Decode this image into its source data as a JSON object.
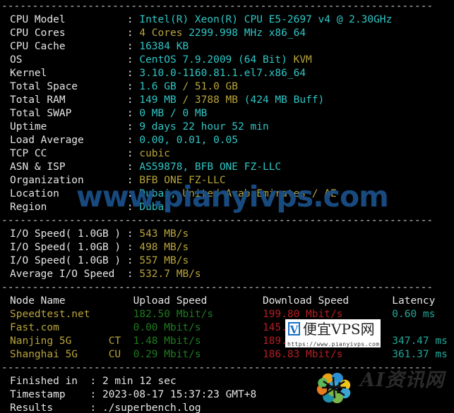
{
  "terminal": {
    "separator": "----------------------------------------------------------------------",
    "colon": ":"
  },
  "sysinfo": {
    "rows": [
      {
        "label": "CPU Model",
        "parts": [
          {
            "t": "Intel(R) Xeon(R) CPU E5-2697 v4 @ 2.30GHz",
            "c": "cy"
          }
        ]
      },
      {
        "label": "CPU Cores",
        "parts": [
          {
            "t": "4 Cores ",
            "c": "ye"
          },
          {
            "t": "2299.998 MHz ",
            "c": "cy"
          },
          {
            "t": "x86_64",
            "c": "cy"
          }
        ]
      },
      {
        "label": "CPU Cache",
        "parts": [
          {
            "t": "16384 KB",
            "c": "cy"
          }
        ]
      },
      {
        "label": "OS",
        "parts": [
          {
            "t": "CentOS 7.9.2009 (64 Bit) ",
            "c": "cy"
          },
          {
            "t": "KVM",
            "c": "ye"
          }
        ]
      },
      {
        "label": "Kernel",
        "parts": [
          {
            "t": "3.10.0-1160.81.1.el7.x86_64",
            "c": "cy"
          }
        ]
      },
      {
        "label": "Total Space",
        "parts": [
          {
            "t": "1.6 GB ",
            "c": "cy"
          },
          {
            "t": "/ 51.0 GB",
            "c": "ye"
          }
        ]
      },
      {
        "label": "Total RAM",
        "parts": [
          {
            "t": "149 MB ",
            "c": "cy"
          },
          {
            "t": "/ 3788 MB ",
            "c": "ye"
          },
          {
            "t": "(424 MB Buff)",
            "c": "cy"
          }
        ]
      },
      {
        "label": "Total SWAP",
        "parts": [
          {
            "t": "0 MB / 0 MB",
            "c": "cy"
          }
        ]
      },
      {
        "label": "Uptime",
        "parts": [
          {
            "t": "9 days 22 hour 52 min",
            "c": "cy"
          }
        ]
      },
      {
        "label": "Load Average",
        "parts": [
          {
            "t": "0.00, 0.01, 0.05",
            "c": "cy"
          }
        ]
      },
      {
        "label": "TCP CC",
        "parts": [
          {
            "t": "cubic",
            "c": "ye"
          }
        ]
      },
      {
        "label": "ASN & ISP",
        "parts": [
          {
            "t": "AS59878, BFB ONE FZ-LLC",
            "c": "cy"
          }
        ]
      },
      {
        "label": "Organization",
        "parts": [
          {
            "t": "BFB ONE FZ-LLC",
            "c": "ye"
          }
        ]
      },
      {
        "label": "Location",
        "parts": [
          {
            "t": "Dubai, ",
            "c": "cy"
          },
          {
            "t": "United Arab Emirates / AE",
            "c": "ye"
          }
        ]
      },
      {
        "label": "Region",
        "parts": [
          {
            "t": "Dubai",
            "c": "cy"
          }
        ]
      }
    ]
  },
  "iospeed": {
    "rows": [
      {
        "label": "I/O Speed( 1.0GB )",
        "parts": [
          {
            "t": "543 MB/s",
            "c": "ye"
          }
        ]
      },
      {
        "label": "I/O Speed( 1.0GB )",
        "parts": [
          {
            "t": "498 MB/s",
            "c": "ye"
          }
        ]
      },
      {
        "label": "I/O Speed( 1.0GB )",
        "parts": [
          {
            "t": "557 MB/s",
            "c": "ye"
          }
        ]
      },
      {
        "label": "Average I/O Speed",
        "parts": [
          {
            "t": "532.7 MB/s",
            "c": "ye"
          }
        ]
      }
    ]
  },
  "speedtest": {
    "headers": {
      "node": "Node Name",
      "upload": "Upload Speed",
      "download": "Download Speed",
      "latency": "Latency"
    },
    "rows": [
      {
        "node": "Speedtest.net",
        "isp": "",
        "upload": "182.50 Mbit/s",
        "download": "199.80 Mbit/s",
        "latency": "0.60 ms"
      },
      {
        "node": "Fast.com",
        "isp": "",
        "upload": "0.00 Mbit/s",
        "download": "145.4 Mbit/s",
        "latency": ""
      },
      {
        "node": "Nanjing 5G",
        "isp": "CT",
        "upload": "1.48 Mbit/s",
        "download": "189.88 Mbit/s",
        "latency": "347.47 ms"
      },
      {
        "node": "Shanghai 5G",
        "isp": "CU",
        "upload": "0.29 Mbit/s",
        "download": "186.83 Mbit/s",
        "latency": "361.37 ms"
      }
    ]
  },
  "footer": {
    "rows": [
      {
        "label": "Finished in",
        "value": "2 min 12 sec"
      },
      {
        "label": "Timestamp",
        "value": "2023-08-17 15:37:23 GMT+8"
      },
      {
        "label": "Results",
        "value": "./superbench.log"
      }
    ]
  },
  "watermarks": {
    "main_text": "www.pianyivps.com",
    "main_color": "#1a4f86",
    "box": {
      "badge": "V",
      "brand": "便宜VPS网",
      "url": "https://www.pianyivps.com"
    },
    "logo_text": "AI资讯网"
  }
}
